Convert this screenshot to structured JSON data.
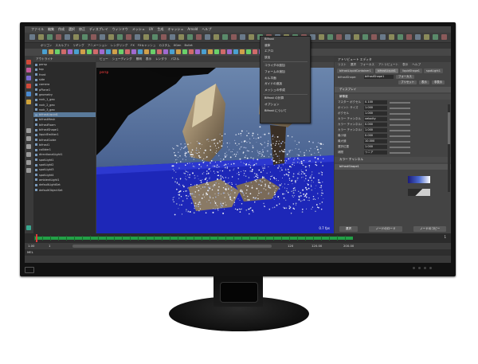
{
  "menubar": {
    "items": [
      "ファイル",
      "編集",
      "作成",
      "選択",
      "修正",
      "ディスプレイ",
      "ウィンドウ",
      "メッシュ",
      "UV",
      "生成",
      "キャッシュ",
      "Arnold",
      "ヘルプ"
    ]
  },
  "shelf_tabs": [
    "ポリゴン",
    "スカルプト",
    "リギング",
    "アニメーション",
    "レンダリング",
    "FX",
    "FXキャッシュ",
    "カスタム",
    "XGen",
    "Bullet"
  ],
  "outliner": {
    "title": "アウトライナ",
    "items": [
      {
        "label": "persp"
      },
      {
        "label": "top"
      },
      {
        "label": "front"
      },
      {
        "label": "side"
      },
      {
        "label": "camera"
      },
      {
        "label": "pPlane1"
      },
      {
        "label": "geometry"
      },
      {
        "label": "rock_1_geo"
      },
      {
        "label": "rock_2_geo"
      },
      {
        "label": "rock_3_geo"
      },
      {
        "label": "bifrostLiquid1"
      },
      {
        "label": "bifrostMesh"
      },
      {
        "label": "bifrostFoam"
      },
      {
        "label": "bifrostShape1"
      },
      {
        "label": "liquidEmitter1"
      },
      {
        "label": "bifrostGuide"
      },
      {
        "label": "bifrost1"
      },
      {
        "label": "collider1"
      },
      {
        "label": "directionalLight1"
      },
      {
        "label": "spotLight1"
      },
      {
        "label": "spotLight2"
      },
      {
        "label": "spotLight3"
      },
      {
        "label": "spotLight4"
      },
      {
        "label": "ambientLight1"
      },
      {
        "label": "defaultLightSet"
      },
      {
        "label": "defaultObjectSet"
      }
    ]
  },
  "viewport": {
    "menu": [
      "ビュー",
      "シェーディング",
      "照明",
      "表示",
      "レンダラ",
      "パネル"
    ],
    "hud_text": "persp",
    "frame_label": "Bifrost",
    "fps_text": "0.7 fps"
  },
  "dropdown": {
    "items": [
      "Bifrost",
      "液体",
      "エアロ",
      "放出",
      "コライダの追加",
      "フォームの追加",
      "キル平面",
      "ガイドの追加",
      "メッシュの作成",
      "Bifrost の計算",
      "オプション",
      "Bifrost について"
    ]
  },
  "attribute_editor": {
    "title": "アトリビュート エディタ",
    "menu": [
      "リスト",
      "選択",
      "フォーカス",
      "アトリビュート",
      "表示",
      "ヘルプ"
    ],
    "tabs": [
      "bifrostLiquidContainer1",
      "bifrostLiquid1",
      "liquidShape1",
      "spotLight1"
    ],
    "node_label": "bifrostShape:",
    "node_value": "bifrostShape1",
    "focus_button": "フォーカス",
    "presets_button": "プリセット",
    "show_button": "表示",
    "hide_button": "非表示",
    "section_display": "ディスプレイ",
    "section_resolution": "解像度",
    "section_color": "カラー チャンネル",
    "section_shape": "bifrostShape1",
    "fields": [
      {
        "label": "マスター ボクセル サイズ",
        "value": "0.100"
      },
      {
        "label": "ポイント サイズ",
        "value": "1.000"
      },
      {
        "label": "ボクセル",
        "value": "1.000"
      },
      {
        "label": "カラー チャンネル",
        "value": "velocity"
      },
      {
        "label": "カラー チャンネルの最小値",
        "value": "0.000"
      },
      {
        "label": "カラー チャンネルの最大値",
        "value": "1.000"
      },
      {
        "label": "最小値",
        "value": "0.000"
      },
      {
        "label": "最大値",
        "value": "10.000"
      },
      {
        "label": "選択位置",
        "value": "1.000"
      },
      {
        "label": "補間",
        "value": "リニア"
      }
    ],
    "bottom_buttons": [
      "選択",
      "ノードのロード",
      "ノードのコピー"
    ]
  },
  "timeline": {
    "start": "1",
    "end": "120",
    "current": "1",
    "range_start": "1.00",
    "range_end": "120.00",
    "anim_end": "200.00"
  },
  "cmdline": {
    "label": "MEL"
  },
  "colors": {
    "timeline_green": "#22a046",
    "viewport_bg_top": "#52709a",
    "viewport_bg_bottom": "#2c3d5c",
    "plane_blue": "#1d27b8",
    "ui_dark": "#3a3a3a"
  }
}
